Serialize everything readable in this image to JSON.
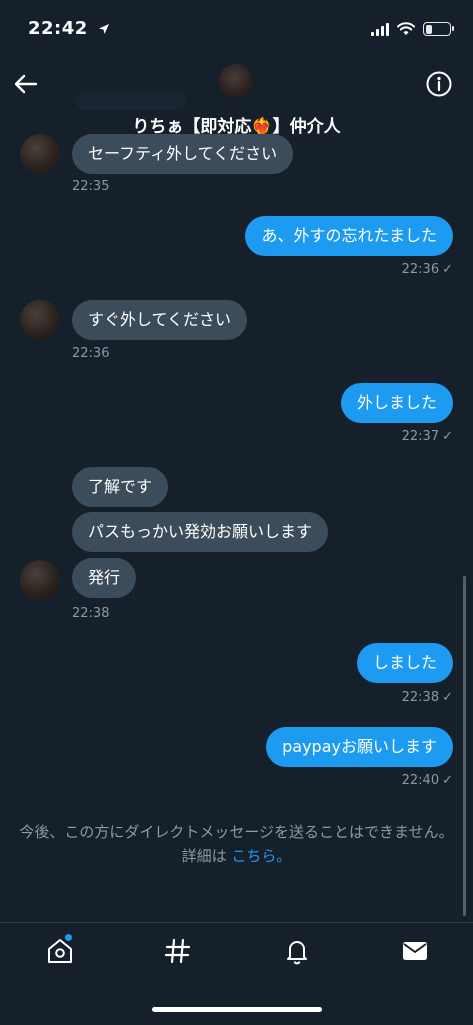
{
  "status_bar": {
    "time": "22:42"
  },
  "header": {
    "title": "りちぁ【即対応❤️‍🔥】仲介人"
  },
  "messages": [
    {
      "text": "セーフティ外してください",
      "time": "22:35"
    },
    {
      "text": "あ、外すの忘れたました",
      "time": "22:36"
    },
    {
      "text": "すぐ外してください",
      "time": "22:36"
    },
    {
      "text": "外しました",
      "time": "22:37"
    },
    {
      "text": "了解です"
    },
    {
      "text": "パスもっかい発効お願いします"
    },
    {
      "text": "発行",
      "time": "22:38"
    },
    {
      "text": "しました",
      "time": "22:38"
    },
    {
      "text": "paypayお願いします",
      "time": "22:40"
    }
  ],
  "check_mark": "✓",
  "notice": {
    "text": "今後、この方にダイレクトメッセージを送ることはできません。詳細は",
    "link": "こちら。"
  },
  "colors": {
    "background": "#15202b",
    "incoming_bubble": "#3d4c5a",
    "outgoing_bubble": "#1d9bf0",
    "muted": "#8b98a5"
  },
  "icons": [
    "back-arrow-icon",
    "info-icon",
    "home-icon",
    "hashtag-icon",
    "bell-icon",
    "mail-icon"
  ]
}
